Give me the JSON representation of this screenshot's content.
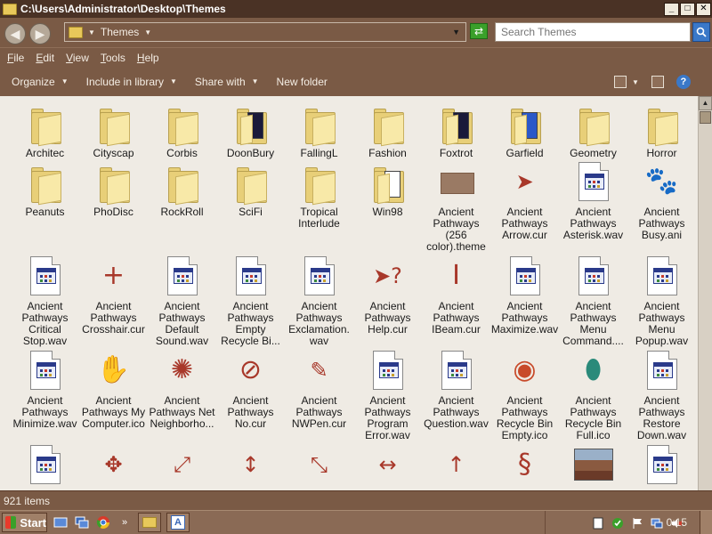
{
  "window": {
    "title": "C:\\Users\\Administrator\\Desktop\\Themes",
    "minimize": "_",
    "maximize": "□",
    "close": "✕"
  },
  "address": {
    "crumb": "Themes",
    "search_placeholder": "Search Themes"
  },
  "menu": [
    "File",
    "Edit",
    "View",
    "Tools",
    "Help"
  ],
  "commands": [
    {
      "label": "Organize",
      "has_menu": true
    },
    {
      "label": "Include in library",
      "has_menu": true
    },
    {
      "label": "Share with",
      "has_menu": true
    },
    {
      "label": "New folder",
      "has_menu": false
    }
  ],
  "status": {
    "item_count": "921 items"
  },
  "taskbar": {
    "start": "Start",
    "clock": "0:15",
    "overflow": "»"
  },
  "items": [
    {
      "label": "Architec",
      "icon": "folder"
    },
    {
      "label": "Cityscap",
      "icon": "folder"
    },
    {
      "label": "Corbis",
      "icon": "folder"
    },
    {
      "label": "DoonBury",
      "icon": "folder-dark"
    },
    {
      "label": "FallingL",
      "icon": "folder"
    },
    {
      "label": "Fashion",
      "icon": "folder"
    },
    {
      "label": "Foxtrot",
      "icon": "folder-dark"
    },
    {
      "label": "Garfield",
      "icon": "folder-blue"
    },
    {
      "label": "Geometry",
      "icon": "folder"
    },
    {
      "label": "Horror",
      "icon": "folder"
    },
    {
      "label": "Peanuts",
      "icon": "folder"
    },
    {
      "label": "PhoDisc",
      "icon": "folder"
    },
    {
      "label": "RockRoll",
      "icon": "folder"
    },
    {
      "label": "SciFi",
      "icon": "folder"
    },
    {
      "label": "Tropical Interlude",
      "icon": "folder"
    },
    {
      "label": "Win98",
      "icon": "folder-white"
    },
    {
      "label": "Ancient Pathways (256 color).theme",
      "icon": "theme-file"
    },
    {
      "label": "Ancient Pathways Arrow.cur",
      "icon": "cursor-arrow"
    },
    {
      "label": "Ancient Pathways Asterisk.wav",
      "icon": "wav-file"
    },
    {
      "label": "Ancient Pathways Busy.ani",
      "icon": "busy-animal"
    },
    {
      "label": "Ancient Pathways Critical Stop.wav",
      "icon": "wav-file"
    },
    {
      "label": "Ancient Pathways Crosshair.cur",
      "icon": "crosshair"
    },
    {
      "label": "Ancient Pathways Default Sound.wav",
      "icon": "wav-file"
    },
    {
      "label": "Ancient Pathways Empty Recycle Bi...",
      "icon": "wav-file"
    },
    {
      "label": "Ancient Pathways Exclamation.wav",
      "icon": "wav-file"
    },
    {
      "label": "Ancient Pathways Help.cur",
      "icon": "cursor-help"
    },
    {
      "label": "Ancient Pathways IBeam.cur",
      "icon": "ibeam"
    },
    {
      "label": "Ancient Pathways Maximize.wav",
      "icon": "wav-file"
    },
    {
      "label": "Ancient Pathways Menu Command....",
      "icon": "wav-file"
    },
    {
      "label": "Ancient Pathways Menu Popup.wav",
      "icon": "wav-file"
    },
    {
      "label": "Ancient Pathways Minimize.wav",
      "icon": "wav-file"
    },
    {
      "label": "Ancient Pathways My Computer.ico",
      "icon": "hand"
    },
    {
      "label": "Ancient Pathways Net Neighborho...",
      "icon": "sun"
    },
    {
      "label": "Ancient Pathways No.cur",
      "icon": "no-sign"
    },
    {
      "label": "Ancient Pathways NWPen.cur",
      "icon": "pen"
    },
    {
      "label": "Ancient Pathways Program Error.wav",
      "icon": "wav-file"
    },
    {
      "label": "Ancient Pathways Question.wav",
      "icon": "wav-file"
    },
    {
      "label": "Ancient Pathways Recycle Bin Empty.ico",
      "icon": "pot-empty"
    },
    {
      "label": "Ancient Pathways Recycle Bin Full.ico",
      "icon": "pot-full"
    },
    {
      "label": "Ancient Pathways Restore Down.wav",
      "icon": "wav-file"
    },
    {
      "label": "",
      "icon": "wav-file"
    },
    {
      "label": "",
      "icon": "move-arrows"
    },
    {
      "label": "",
      "icon": "resize-diag-ne"
    },
    {
      "label": "",
      "icon": "resize-vert"
    },
    {
      "label": "",
      "icon": "resize-diag-nw"
    },
    {
      "label": "",
      "icon": "resize-horiz"
    },
    {
      "label": "",
      "icon": "up-arrow"
    },
    {
      "label": "",
      "icon": "snake"
    },
    {
      "label": "",
      "icon": "photo"
    },
    {
      "label": "",
      "icon": "wav-file"
    }
  ]
}
